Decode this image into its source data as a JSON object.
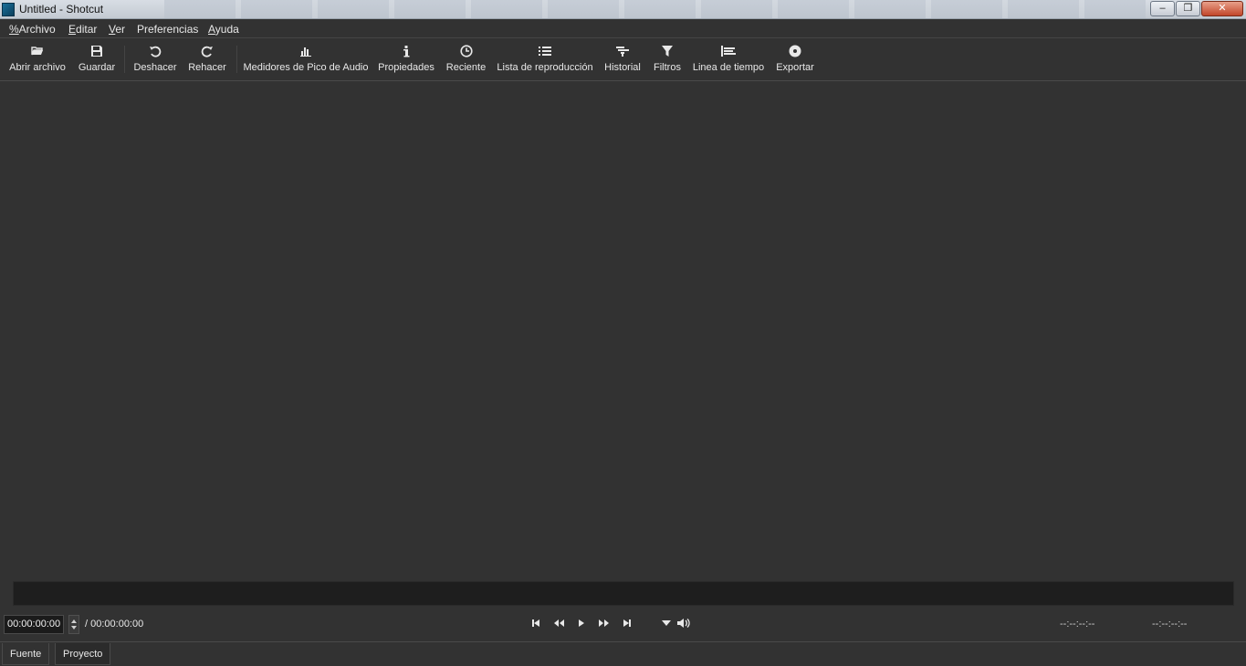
{
  "window": {
    "title": "Untitled - Shotcut",
    "minimize": "–",
    "maximize": "❐",
    "close": "✕"
  },
  "menu": {
    "file": {
      "underline": "%",
      "rest": "Archivo"
    },
    "edit": {
      "underline": "E",
      "rest": "ditar"
    },
    "view": {
      "underline": "V",
      "rest": "er"
    },
    "preferences": {
      "underline": "",
      "rest": "Preferencias"
    },
    "help": {
      "underline": "A",
      "rest": "yuda"
    }
  },
  "toolbar": {
    "open": {
      "label": "Abrir archivo",
      "icon": "folder-open-icon"
    },
    "save": {
      "label": "Guardar",
      "icon": "save-icon"
    },
    "undo": {
      "label": "Deshacer",
      "icon": "undo-icon"
    },
    "redo": {
      "label": "Rehacer",
      "icon": "redo-icon"
    },
    "meters": {
      "label": "Medidores de Pico de Audio",
      "icon": "audio-meter-icon"
    },
    "properties": {
      "label": "Propiedades",
      "icon": "info-icon"
    },
    "recent": {
      "label": "Reciente",
      "icon": "clock-icon"
    },
    "playlist": {
      "label": "Lista de reproducción",
      "icon": "list-icon"
    },
    "history": {
      "label": "Historial",
      "icon": "history-icon"
    },
    "filters": {
      "label": "Filtros",
      "icon": "filter-icon"
    },
    "timeline": {
      "label": "Linea de tiempo",
      "icon": "timeline-icon"
    },
    "export": {
      "label": "Exportar",
      "icon": "export-disc-icon"
    }
  },
  "transport": {
    "position": "00:00:00:00",
    "duration": "/ 00:00:00:00",
    "in_point": "--:--:--:--",
    "out_point": "--:--:--:--"
  },
  "tabs": {
    "source": "Fuente",
    "project": "Proyecto"
  },
  "colors": {
    "background": "#323232",
    "scrubber": "#1e1e1e",
    "text": "#e8e8e8"
  }
}
